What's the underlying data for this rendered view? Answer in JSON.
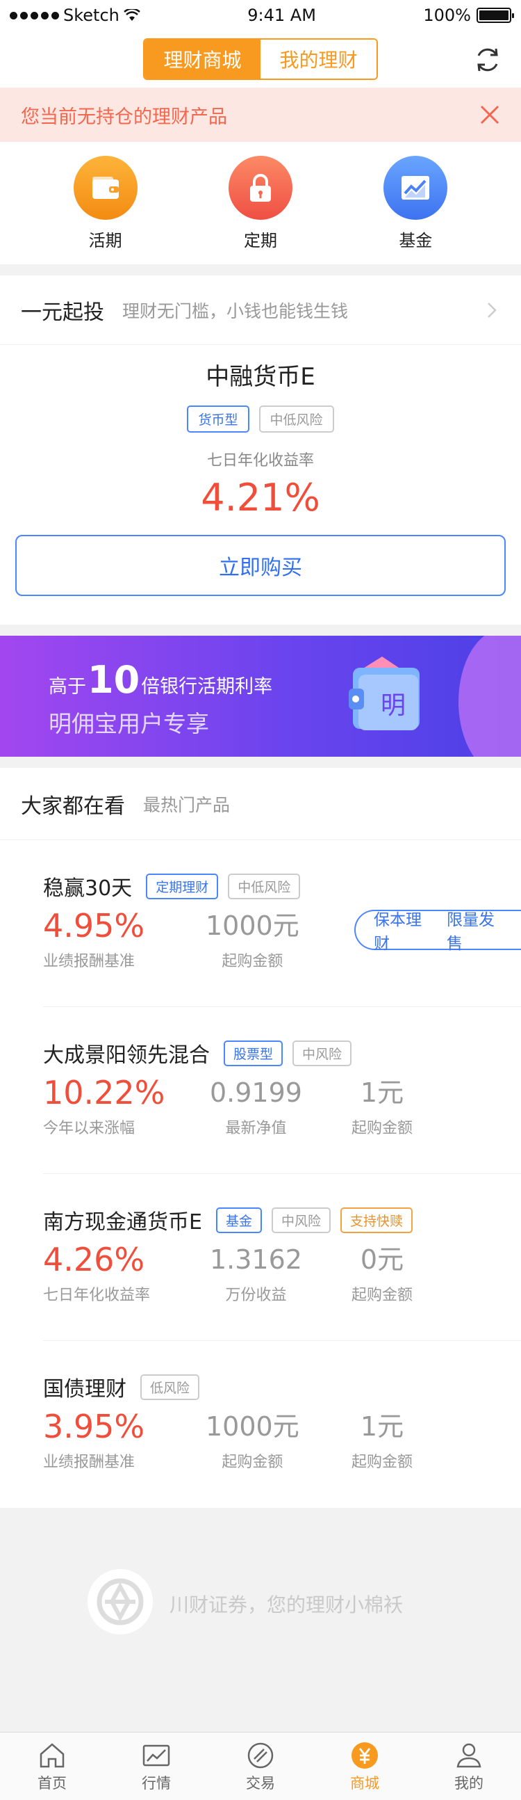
{
  "status": {
    "carrier": "Sketch",
    "time": "9:41 AM",
    "battery_text": "100%"
  },
  "header": {
    "tab_mall": "理财商城",
    "tab_mine": "我的理财"
  },
  "notice": {
    "text": "您当前无持仓的理财产品"
  },
  "categories": [
    {
      "label": "活期",
      "icon": "wallet-icon",
      "color": "#f79a1f"
    },
    {
      "label": "定期",
      "icon": "lock-icon",
      "color": "#f4674f"
    },
    {
      "label": "基金",
      "icon": "chart-icon",
      "color": "#4a86ff"
    }
  ],
  "starter": {
    "title": "一元起投",
    "subtitle": "理财无门槛，小钱也能钱生钱",
    "product_name": "中融货币E",
    "tags": [
      "货币型",
      "中低风险"
    ],
    "rate_label": "七日年化收益率",
    "rate": "4.21%",
    "buy_label": "立即购买"
  },
  "banner": {
    "line1_prefix": "高于",
    "line1_number": "10",
    "line1_suffix": "倍银行活期利率",
    "line2": "明佣宝用户专享",
    "wallet_char": "明"
  },
  "hot": {
    "title": "大家都在看",
    "subtitle": "最热门产品",
    "items": [
      {
        "name": "稳赢30天",
        "tags": [
          {
            "text": "定期理财",
            "style": "blue"
          },
          {
            "text": "中低风险",
            "style": "gray"
          }
        ],
        "cols": [
          {
            "value": "4.95%",
            "label": "业绩报酬基准"
          },
          {
            "value": "1000元",
            "label": "起购金额"
          }
        ],
        "pill": [
          "保本理财",
          "限量发售"
        ]
      },
      {
        "name": "大成景阳领先混合",
        "tags": [
          {
            "text": "股票型",
            "style": "blue"
          },
          {
            "text": "中风险",
            "style": "gray"
          }
        ],
        "cols": [
          {
            "value": "10.22%",
            "label": "今年以来涨幅"
          },
          {
            "value": "0.9199",
            "label": "最新净值"
          },
          {
            "value": "1元",
            "label": "起购金额"
          }
        ]
      },
      {
        "name": "南方现金通货币E",
        "tags": [
          {
            "text": "基金",
            "style": "blue"
          },
          {
            "text": "中风险",
            "style": "gray"
          },
          {
            "text": "支持快赎",
            "style": "orange"
          }
        ],
        "cols": [
          {
            "value": "4.26%",
            "label": "七日年化收益率"
          },
          {
            "value": "1.3162",
            "label": "万份收益"
          },
          {
            "value": "0元",
            "label": "起购金额"
          }
        ]
      },
      {
        "name": "国债理财",
        "tags": [
          {
            "text": "低风险",
            "style": "gray"
          }
        ],
        "cols": [
          {
            "value": "3.95%",
            "label": "业绩报酬基准"
          },
          {
            "value": "1000元",
            "label": "起购金额"
          },
          {
            "value": "1元",
            "label": "起购金额"
          }
        ]
      }
    ]
  },
  "slogan": {
    "text": "川财证券，您的理财小棉袄"
  },
  "tabbar": [
    {
      "label": "首页",
      "icon": "home-icon"
    },
    {
      "label": "行情",
      "icon": "market-icon"
    },
    {
      "label": "交易",
      "icon": "trade-icon"
    },
    {
      "label": "商城",
      "icon": "mall-icon",
      "active": true
    },
    {
      "label": "我的",
      "icon": "profile-icon"
    }
  ]
}
